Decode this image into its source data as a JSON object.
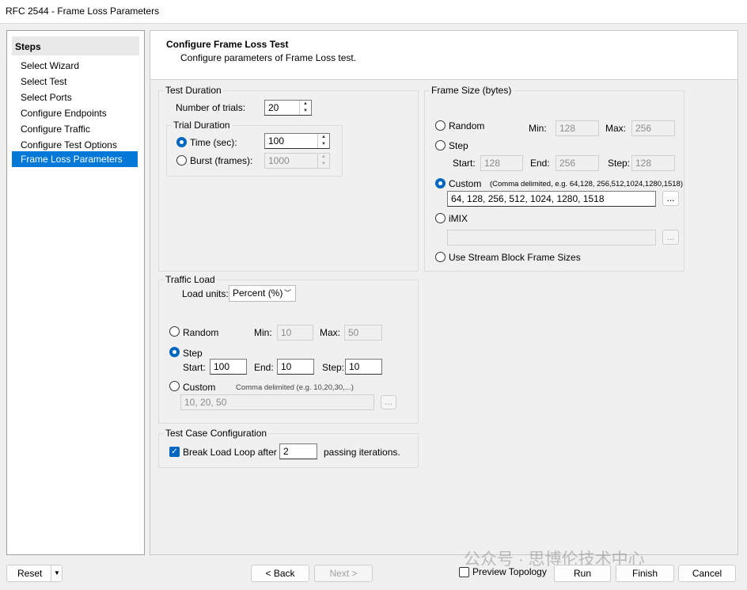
{
  "window": {
    "title": "RFC 2544 - Frame Loss Parameters"
  },
  "sidebar": {
    "header": "Steps",
    "items": [
      {
        "label": "Select Wizard"
      },
      {
        "label": "Select Test"
      },
      {
        "label": "Select Ports"
      },
      {
        "label": "Configure Endpoints"
      },
      {
        "label": "Configure Traffic"
      },
      {
        "label": "Configure Test Options"
      },
      {
        "label": "Frame Loss Parameters",
        "selected": true
      }
    ]
  },
  "header": {
    "title": "Configure Frame Loss Test",
    "subtitle": "Configure parameters of Frame Loss test."
  },
  "test_duration": {
    "legend": "Test Duration",
    "trials_label": "Number of trials:",
    "trials_value": "20",
    "trial_duration": {
      "legend": "Trial Duration",
      "time_label": "Time (sec):",
      "time_value": "100",
      "time_selected": true,
      "burst_label": "Burst (frames):",
      "burst_value": "1000"
    }
  },
  "frame_size": {
    "legend": "Frame Size (bytes)",
    "random": {
      "label": "Random",
      "min_label": "Min:",
      "min": "128",
      "max_label": "Max:",
      "max": "256"
    },
    "step": {
      "label": "Step",
      "start_label": "Start:",
      "start": "128",
      "end_label": "End:",
      "end": "256",
      "step_label": "Step:",
      "step": "128"
    },
    "custom": {
      "label": "Custom",
      "hint": "(Comma delimited, e.g. 64,128, 256,512,1024,1280,1518)",
      "value": "64, 128, 256, 512, 1024, 1280, 1518",
      "selected": true
    },
    "imix": {
      "label": "iMIX",
      "value": ""
    },
    "stream_block": {
      "label": "Use Stream Block Frame Sizes"
    },
    "browse_label": "..."
  },
  "traffic_load": {
    "legend": "Traffic Load",
    "units_label": "Load units:",
    "units_value": "Percent (%)",
    "random": {
      "label": "Random",
      "min_label": "Min:",
      "min": "10",
      "max_label": "Max:",
      "max": "50"
    },
    "step": {
      "label": "Step",
      "selected": true,
      "start_label": "Start:",
      "start": "100",
      "end_label": "End:",
      "end": "10",
      "step_label": "Step:",
      "step": "10"
    },
    "custom": {
      "label": "Custom",
      "hint": "Comma delimited (e.g. 10,20,30,...)",
      "value": "10, 20, 50"
    },
    "browse_label": "..."
  },
  "test_case": {
    "legend": "Test Case Configuration",
    "break_label": "Break Load Loop after",
    "break_checked": true,
    "break_value": "2",
    "suffix": "passing iterations."
  },
  "footer": {
    "reset": "Reset",
    "back": "< Back",
    "next": "Next >",
    "preview": "Preview Topology",
    "run": "Run",
    "finish": "Finish",
    "cancel": "Cancel"
  },
  "watermark": "公众号 · 思博伦技术中心",
  "colors": {
    "accent": "#0078d7"
  }
}
